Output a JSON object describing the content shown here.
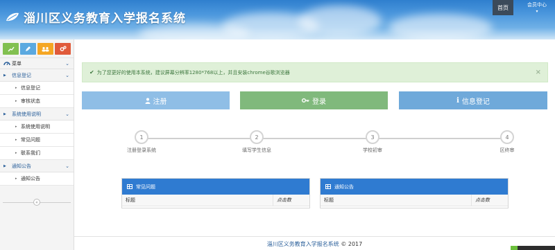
{
  "header": {
    "title": "淄川区义务教育入学报名系统",
    "nav": {
      "home": "首页",
      "member": "会员中心"
    }
  },
  "sidebar": {
    "shortcut_icons": [
      "chart-icon",
      "pencil-icon",
      "users-icon",
      "cogs-icon"
    ],
    "menu_label": "菜单",
    "groups": [
      {
        "label": "信息登记",
        "items": [
          "信息登记",
          "审核状态"
        ]
      },
      {
        "label": "系统使用说明",
        "items": [
          "系统使用说明",
          "常见问题",
          "联系我们"
        ]
      },
      {
        "label": "通知公告",
        "items": [
          "通知公告"
        ]
      }
    ]
  },
  "alert": {
    "text": "为了您更好的使用本系统，建议屏幕分辨率1280*768以上，并且安装chrome谷歌浏览器",
    "close": "×"
  },
  "actions": {
    "register": "注册",
    "login": "登录",
    "info": "信息登记"
  },
  "steps": [
    {
      "num": "1",
      "label": "注册登录系统"
    },
    {
      "num": "2",
      "label": "填写学生信息"
    },
    {
      "num": "3",
      "label": "学校初审"
    },
    {
      "num": "4",
      "label": "区终审"
    }
  ],
  "panels": {
    "faq": {
      "title": "常见问题",
      "col_title": "标题",
      "col_clicks": "点击数"
    },
    "notice": {
      "title": "通知公告",
      "col_title": "标题",
      "col_clicks": "点击数"
    }
  },
  "footer": {
    "name": "淄川区义务教育入学报名系统",
    "copyright": "© 2017"
  },
  "colors": {
    "header_blue": "#2f7fce",
    "register": "#8fbee6",
    "login": "#80b97c",
    "info": "#6fa9da",
    "panel_head": "#2f7bd1",
    "alert_bg": "#dff0d8"
  }
}
